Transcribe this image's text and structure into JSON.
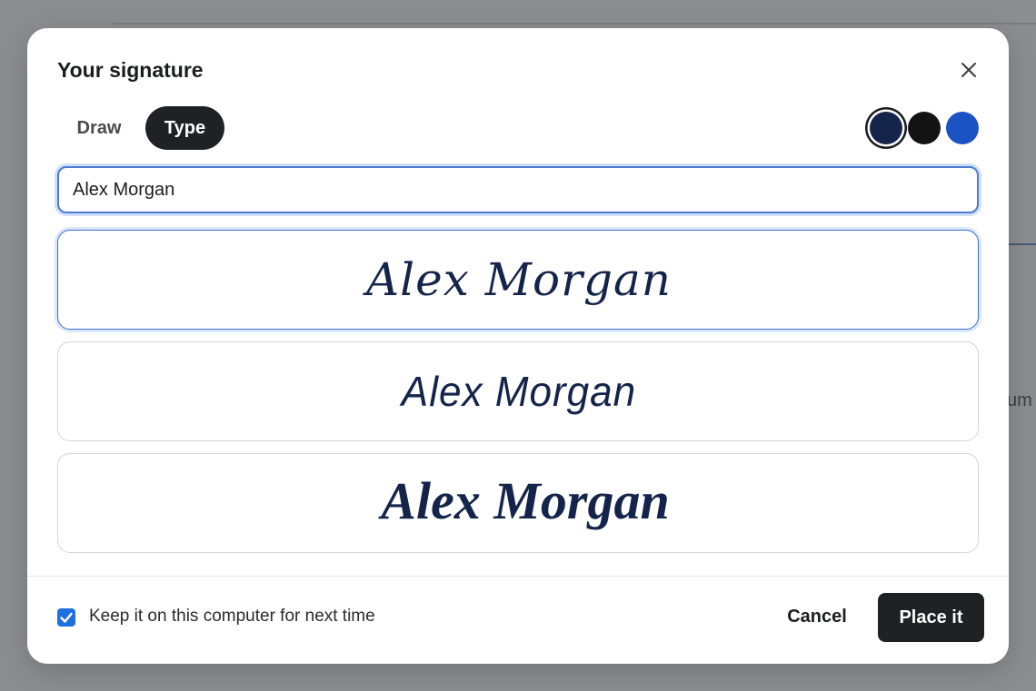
{
  "background": {
    "partial_text": "um"
  },
  "dialog": {
    "title": "Your signature",
    "close_icon": "close-icon",
    "tabs": [
      {
        "label": "Draw",
        "active": false
      },
      {
        "label": "Type",
        "active": true
      }
    ],
    "colors": [
      {
        "name": "navy",
        "hex": "#15244a",
        "selected": true
      },
      {
        "name": "black",
        "hex": "#131313",
        "selected": false
      },
      {
        "name": "blue",
        "hex": "#1c53c4",
        "selected": false
      }
    ],
    "name_input": {
      "value": "Alex Morgan"
    },
    "signature_options": [
      {
        "text": "Alex Morgan",
        "style": "script-italic",
        "selected": true
      },
      {
        "text": "Alex Morgan",
        "style": "handwriting-light",
        "selected": false
      },
      {
        "text": "Alex Morgan",
        "style": "calligraphic-bold",
        "selected": false
      }
    ],
    "footer": {
      "remember_label": "Keep it on this computer for next time",
      "remember_checked": true,
      "cancel_label": "Cancel",
      "place_label": "Place it"
    }
  }
}
